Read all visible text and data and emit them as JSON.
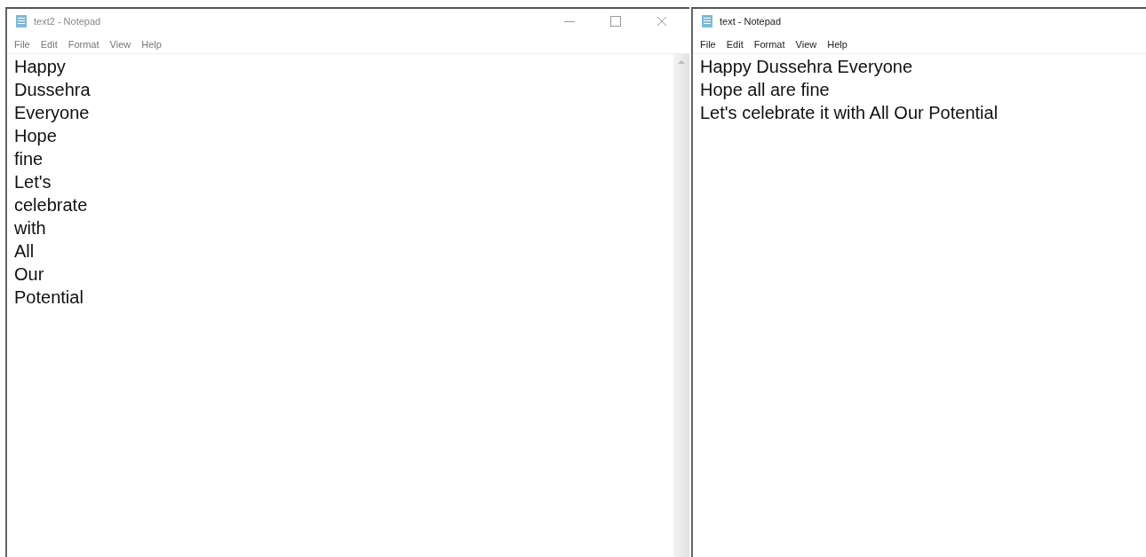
{
  "windows": [
    {
      "title": "text2 - Notepad",
      "controls": true,
      "scrollbar": true,
      "menu": [
        "File",
        "Edit",
        "Format",
        "View",
        "Help"
      ],
      "lines": [
        "Happy",
        "Dussehra",
        "Everyone",
        "Hope",
        "fine",
        "Let's",
        "celebrate",
        "with",
        "All",
        "Our",
        "Potential"
      ]
    },
    {
      "title": "text - Notepad",
      "controls": false,
      "scrollbar": false,
      "menu": [
        "File",
        "Edit",
        "Format",
        "View",
        "Help"
      ],
      "lines": [
        "Happy Dussehra Everyone",
        "Hope all are fine",
        "Let's celebrate it with All Our Potential"
      ]
    }
  ]
}
